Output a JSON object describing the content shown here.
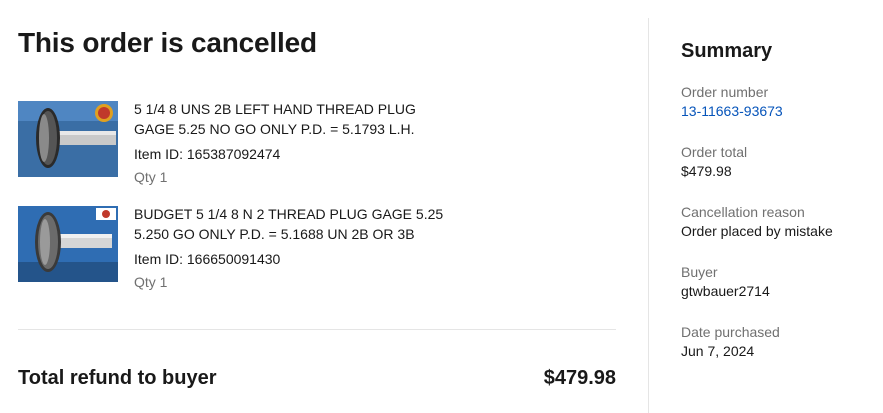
{
  "page": {
    "title": "This order is cancelled"
  },
  "items": [
    {
      "title": "5 1/4 8 UNS 2B LEFT HAND THREAD PLUG GAGE 5.25 NO GO ONLY P.D. = 5.1793 L.H.",
      "item_id": "Item ID: 165387092474",
      "qty": "Qty 1",
      "image": "thread-plug-gage-photo"
    },
    {
      "title": "BUDGET 5 1/4 8 N 2 THREAD PLUG GAGE 5.25 5.250 GO ONLY P.D. = 5.1688 UN 2B OR 3B",
      "item_id": "Item ID: 166650091430",
      "qty": "Qty 1",
      "image": "thread-plug-gage-photo"
    }
  ],
  "total": {
    "label": "Total refund to buyer",
    "value": "$479.98"
  },
  "summary": {
    "title": "Summary",
    "fields": [
      {
        "label": "Order number",
        "value": "13-11663-93673"
      },
      {
        "label": "Order total",
        "value": "$479.98"
      },
      {
        "label": "Cancellation reason",
        "value": "Order placed by mistake"
      },
      {
        "label": "Buyer",
        "value": "gtwbauer2714"
      },
      {
        "label": "Date purchased",
        "value": "Jun 7, 2024"
      }
    ]
  },
  "colors": {
    "text": "#191919",
    "muted": "#707070",
    "link": "#0654ba",
    "divider": "#e5e5e5"
  }
}
